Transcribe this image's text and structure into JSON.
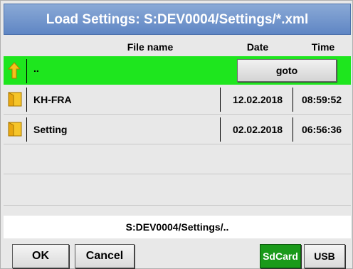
{
  "window": {
    "title": "Load Settings:  S:DEV0004/Settings/*.xml"
  },
  "columns": {
    "file_name": "File name",
    "date": "Date",
    "time": "Time"
  },
  "up_row": {
    "name": "..",
    "goto_label": "goto"
  },
  "files": [
    {
      "name": "KH-FRA",
      "date": "12.02.2018",
      "time": "08:59:52"
    },
    {
      "name": "Setting",
      "date": "02.02.2018",
      "time": "06:56:36"
    }
  ],
  "current_path": "S:DEV0004/Settings/..",
  "buttons": {
    "ok": "OK",
    "cancel": "Cancel",
    "sdcard": "SdCard",
    "usb": "USB"
  },
  "colors": {
    "title_bar": "#6f93cc",
    "selected_row": "#1ee61e",
    "sdcard_active": "#1a9a1a"
  },
  "icons": {
    "up": "up-arrow-icon",
    "folder": "folder-icon"
  }
}
